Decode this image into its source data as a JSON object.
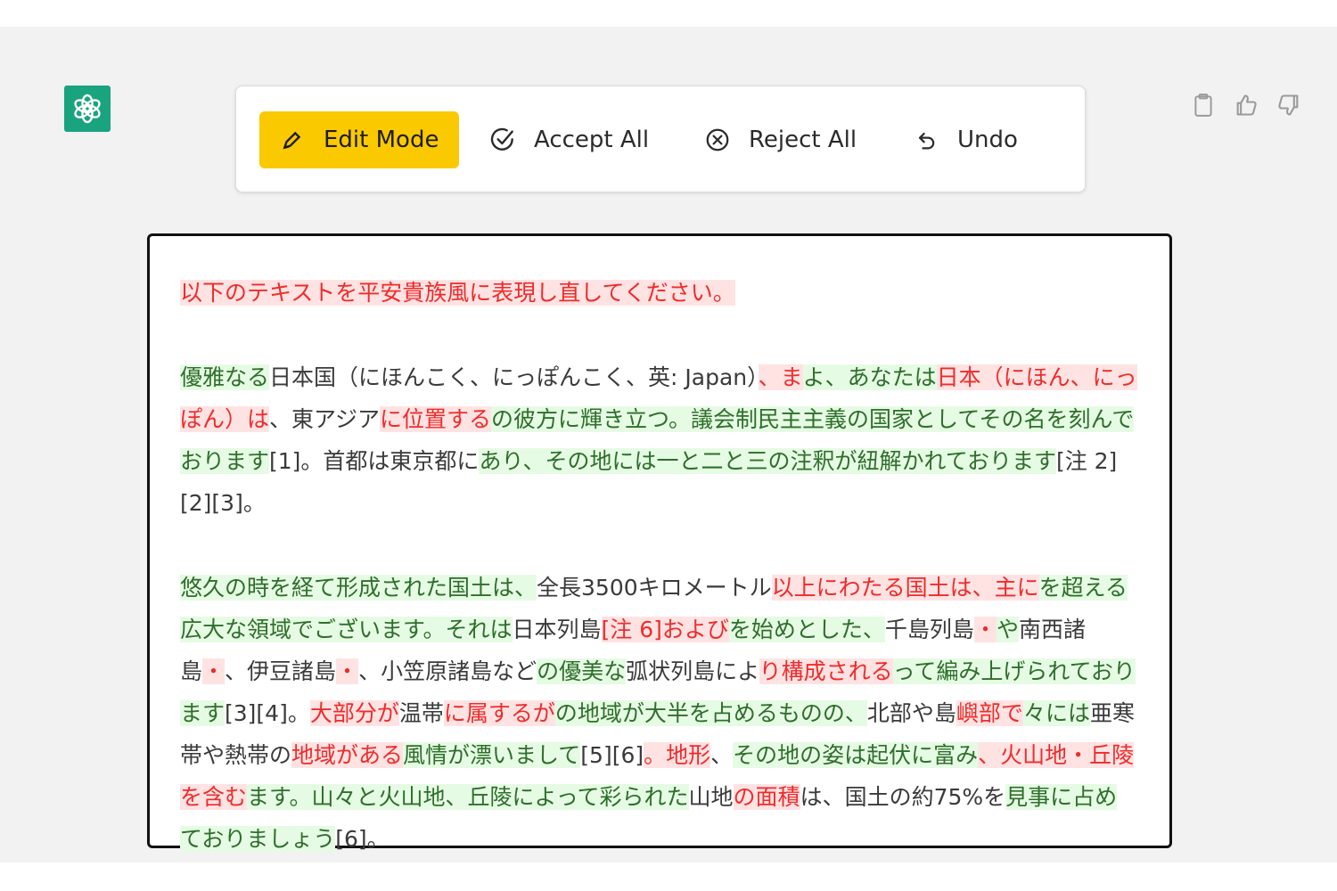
{
  "toolbar": {
    "edit_mode": "Edit Mode",
    "accept_all": "Accept All",
    "reject_all": "Reject All",
    "undo": "Undo"
  },
  "icons": {
    "logo": "openai-logo-icon",
    "edit": "pencil-icon",
    "accept": "check-circle-icon",
    "reject": "x-circle-icon",
    "undo": "undo-icon",
    "copy": "clipboard-icon",
    "like": "thumbs-up-icon",
    "dislike": "thumbs-down-icon"
  },
  "colors": {
    "accent": "#fbc900",
    "insert_text": "#2e6f2b",
    "insert_bg": "#e6fbe4",
    "delete_text": "#ef2b2b",
    "delete_bg": "#ffe3e3",
    "logo_bg": "#19a37f"
  },
  "paragraphs": [
    [
      {
        "t": "del",
        "text": "以下のテキストを平安貴族風に表現し直してください。"
      }
    ],
    [
      {
        "t": "ins",
        "text": "優雅なる"
      },
      {
        "t": "plain",
        "text": "日本国（にほんこく、にっぽんこく、英: Japan）"
      },
      {
        "t": "del",
        "text": "、ま"
      },
      {
        "t": "ins",
        "text": "よ、あなたは"
      },
      {
        "t": "del",
        "text": "日本（にほん、にっぽん）は"
      },
      {
        "t": "plain",
        "text": "、東アジア"
      },
      {
        "t": "del",
        "text": "に位置する"
      },
      {
        "t": "ins",
        "text": "の彼方に輝き立つ。議会制民主主義の国家としてその名を刻んでおります"
      },
      {
        "t": "plain",
        "text": "[1]。首都は東京都に"
      },
      {
        "t": "ins",
        "text": "あり、その地には一と二と三の注釈が紐解かれております"
      },
      {
        "t": "plain",
        "text": "[注 2][2][3]。"
      }
    ],
    [
      {
        "t": "ins",
        "text": "悠久の時を経て形成された国土は、"
      },
      {
        "t": "plain",
        "text": "全長3500キロメートル"
      },
      {
        "t": "del",
        "text": "以上にわたる国土は、主に"
      },
      {
        "t": "ins",
        "text": "を超える広大な領域でございます。それは"
      },
      {
        "t": "plain",
        "text": "日本列島"
      },
      {
        "t": "del",
        "text": "[注 6]および"
      },
      {
        "t": "ins",
        "text": "を始めとした、"
      },
      {
        "t": "plain",
        "text": "千島列島"
      },
      {
        "t": "del",
        "text": "・"
      },
      {
        "t": "ins",
        "text": "や"
      },
      {
        "t": "plain",
        "text": "南西諸島"
      },
      {
        "t": "del",
        "text": "・"
      },
      {
        "t": "plain",
        "text": "、伊豆諸島"
      },
      {
        "t": "del",
        "text": "・"
      },
      {
        "t": "plain",
        "text": "、小笠原諸島など"
      },
      {
        "t": "ins",
        "text": "の優美な"
      },
      {
        "t": "plain",
        "text": "弧状列島によ"
      },
      {
        "t": "del",
        "text": "り構成される"
      },
      {
        "t": "ins",
        "text": "って編み上げられております"
      },
      {
        "t": "plain",
        "text": "[3][4]。"
      },
      {
        "t": "del",
        "text": "大部分が"
      },
      {
        "t": "plain",
        "text": "温帯"
      },
      {
        "t": "del",
        "text": "に属するが"
      },
      {
        "t": "ins",
        "text": "の地域が大半を占めるものの、"
      },
      {
        "t": "plain",
        "text": "北部や島"
      },
      {
        "t": "del",
        "text": "嶼部で"
      },
      {
        "t": "ins",
        "text": "々には"
      },
      {
        "t": "plain",
        "text": "亜寒帯や熱帯の"
      },
      {
        "t": "del",
        "text": "地域がある"
      },
      {
        "t": "ins",
        "text": "風情が漂いまして"
      },
      {
        "t": "plain",
        "text": "[5][6]"
      },
      {
        "t": "del",
        "text": "。地形"
      },
      {
        "t": "plain",
        "text": "、"
      },
      {
        "t": "ins",
        "text": "その地の姿は起伏に富み"
      },
      {
        "t": "del",
        "text": "、火山地・丘陵を含む"
      },
      {
        "t": "ins",
        "text": "ます。山々と火山地、丘陵によって彩られた"
      },
      {
        "t": "plain",
        "text": "山地"
      },
      {
        "t": "del",
        "text": "の面積"
      },
      {
        "t": "plain",
        "text": "は、国土の約75%を"
      },
      {
        "t": "ins",
        "text": "見事に占めておりましょう"
      },
      {
        "t": "plain",
        "text": "[6]。"
      }
    ]
  ]
}
